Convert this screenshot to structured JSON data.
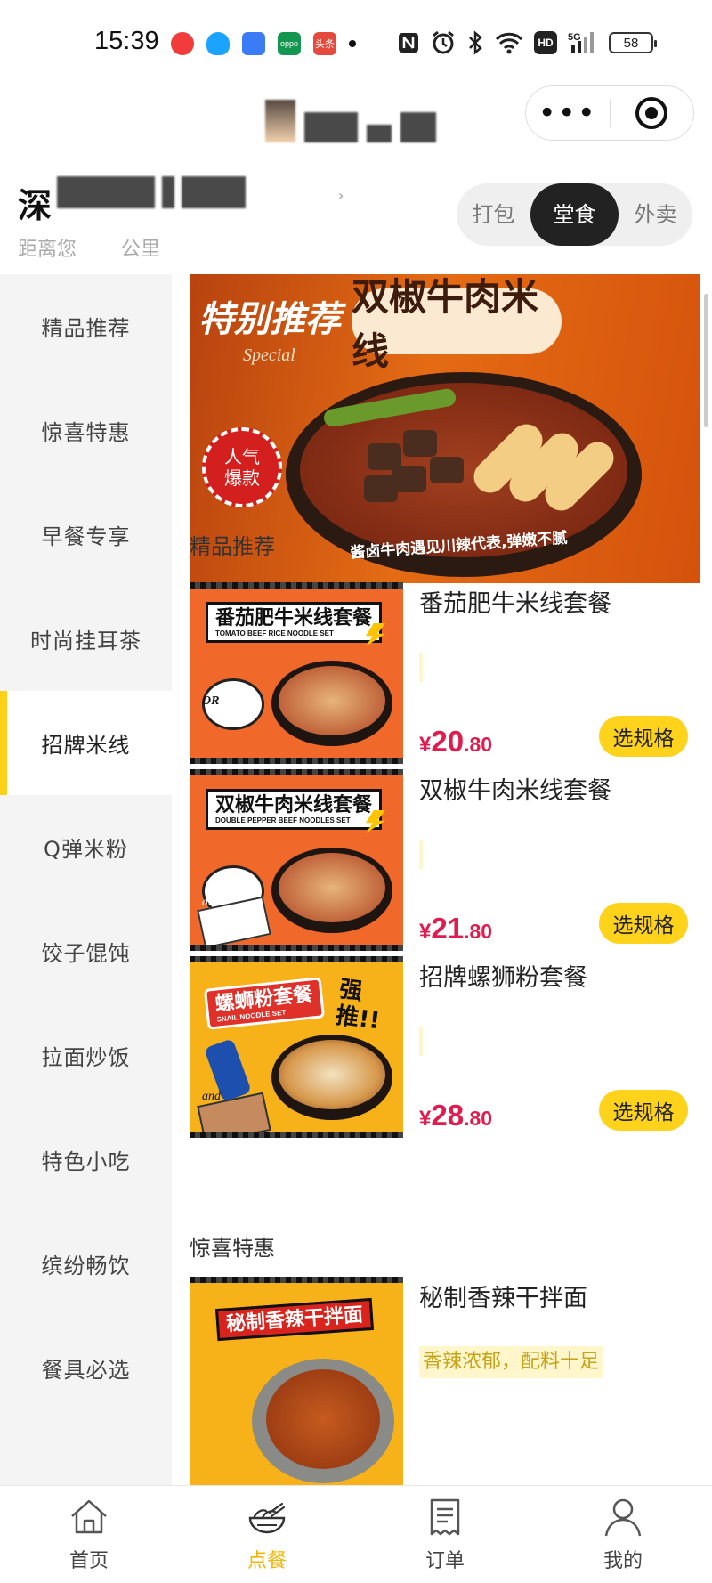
{
  "status_bar": {
    "time": "15:39",
    "app_icons": [
      {
        "name": "video-app-icon",
        "color": "#f23c3c",
        "text": ""
      },
      {
        "name": "qq-icon",
        "color": "#1aa3ff",
        "text": ""
      },
      {
        "name": "browser-app-icon",
        "color": "#3b7bf5",
        "text": ""
      },
      {
        "name": "oppo-app-icon",
        "color": "#129650",
        "text": "oppo"
      },
      {
        "name": "toutiao-app-icon",
        "color": "#e64a3c",
        "text": "头条"
      }
    ],
    "network_label": "5G",
    "hd_label": "HD",
    "battery": "58"
  },
  "capsule": {
    "more_label": "•••"
  },
  "store": {
    "name_first_char": "深",
    "distance_prefix": "距离您",
    "distance_suffix": "公里"
  },
  "order_modes": [
    {
      "label": "打包",
      "active": false
    },
    {
      "label": "堂食",
      "active": true
    },
    {
      "label": "外卖",
      "active": false
    }
  ],
  "categories": [
    {
      "label": "精品推荐"
    },
    {
      "label": "惊喜特惠"
    },
    {
      "label": "早餐专享"
    },
    {
      "label": "时尚挂耳茶"
    },
    {
      "label": "招牌米线"
    },
    {
      "label": "Q弹米粉"
    },
    {
      "label": "饺子馄饨"
    },
    {
      "label": "拉面炒饭"
    },
    {
      "label": "特色小吃"
    },
    {
      "label": "缤纷畅饮"
    },
    {
      "label": "餐具必选"
    }
  ],
  "active_category_index": 4,
  "banner": {
    "tag": "特别推荐",
    "tag_en": "Special",
    "title": "双椒牛肉米线",
    "badge_line1": "人气",
    "badge_line2": "爆款",
    "caption": "酱卤牛肉遇见川辣代表,弹嫩不腻"
  },
  "sections": [
    {
      "title": "精品推荐",
      "items": [
        {
          "name": "番茄肥牛米线套餐",
          "desc": "",
          "price_currency": "¥",
          "price_int": "20",
          "price_dec": ".80",
          "button": "选规格",
          "thumb_label": "番茄肥牛米线套餐",
          "thumb_label_en": "TOMATO BEEF RICE NOODLE SET",
          "thumb_side_text": "OR",
          "thumb_bg": "#f0682a"
        },
        {
          "name": "双椒牛肉米线套餐",
          "desc": "",
          "price_currency": "¥",
          "price_int": "21",
          "price_dec": ".80",
          "button": "选规格",
          "thumb_label": "双椒牛肉米线套餐",
          "thumb_label_en": "DOUBLE PEPPER BEEF NOODLES SET",
          "thumb_side_text": "and",
          "thumb_bg": "#f0682a"
        },
        {
          "name": "招牌螺狮粉套餐",
          "desc": "",
          "price_currency": "¥",
          "price_int": "28",
          "price_dec": ".80",
          "button": "选规格",
          "thumb_label": "螺蛳粉套餐",
          "thumb_label_en": "SNAIL NOODLE SET",
          "thumb_side_text": "and",
          "thumb_extra": "强推!!",
          "thumb_bg": "#f7b21a"
        }
      ]
    },
    {
      "title": "惊喜特惠",
      "items": [
        {
          "name": "秘制香辣干拌面",
          "desc": "香辣浓郁，配料十足",
          "thumb_label": "秘制香辣干拌面",
          "thumb_bg": "#f7b21a"
        }
      ]
    }
  ],
  "tabbar": [
    {
      "label": "首页",
      "icon": "home-icon",
      "active": false
    },
    {
      "label": "点餐",
      "icon": "bowl-icon",
      "active": true
    },
    {
      "label": "订单",
      "icon": "receipt-icon",
      "active": false
    },
    {
      "label": "我的",
      "icon": "user-icon",
      "active": false
    }
  ],
  "colors": {
    "accent_yellow": "#ffd31c",
    "price_red": "#e11b4e",
    "active_tab": "#f5b400",
    "sidebar_bg": "#f4f4f4"
  }
}
